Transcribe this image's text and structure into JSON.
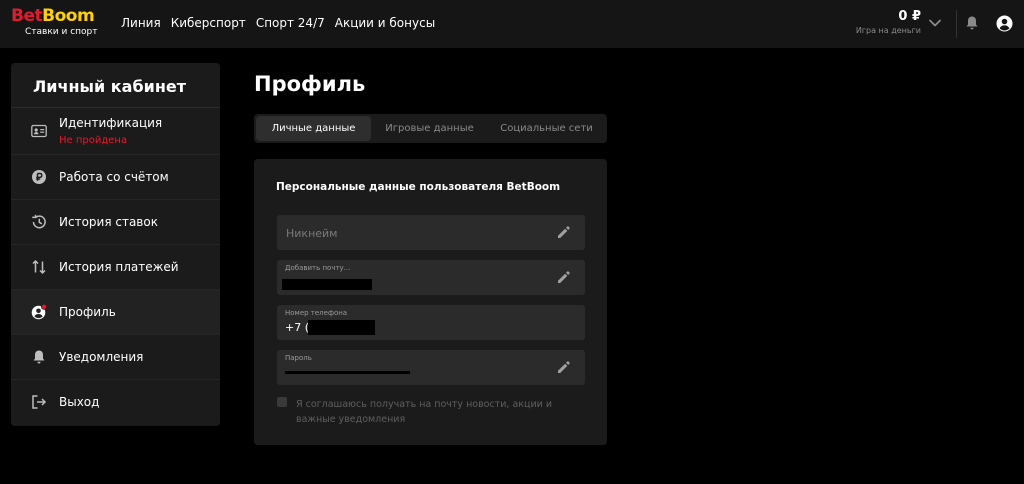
{
  "header": {
    "logo_bet": "Bet",
    "logo_boom": "Boom",
    "logo_sub": "Ставки и спорт",
    "nav": [
      "Линия",
      "Киберспорт",
      "Спорт 24/7",
      "Акции и бонусы"
    ],
    "balance": "0 ₽",
    "balance_label": "Игра на деньги"
  },
  "sidebar": {
    "title": "Личный кабинет",
    "items": [
      {
        "label": "Идентификация",
        "sub": "Не пройдена",
        "icon": "id-card-icon"
      },
      {
        "label": "Работа со счётом",
        "icon": "ruble-coin-icon"
      },
      {
        "label": "История ставок",
        "icon": "history-icon"
      },
      {
        "label": "История платежей",
        "icon": "transfer-arrows-icon"
      },
      {
        "label": "Профиль",
        "icon": "profile-icon"
      },
      {
        "label": "Уведомления",
        "icon": "bell-icon"
      },
      {
        "label": "Выход",
        "icon": "logout-icon"
      }
    ]
  },
  "main": {
    "title": "Профиль",
    "tabs": [
      "Личные данные",
      "Игровые данные",
      "Социальные сети"
    ],
    "card_title": "Персональные данные пользователя BetBoom",
    "nickname_placeholder": "Никнейм",
    "email_label": "Добавить почту...",
    "phone_label": "Номер телефона",
    "phone_value": "+7 (9",
    "password_label": "Пароль",
    "consent_text": "Я соглашаюсь получать на почту новости, акции и важные уведомления"
  },
  "colors": {
    "accent_red": "#e8192c",
    "accent_yellow": "#ffd200",
    "background": "#000000",
    "panel": "#1b1b1b",
    "field": "#2b2b2b"
  }
}
